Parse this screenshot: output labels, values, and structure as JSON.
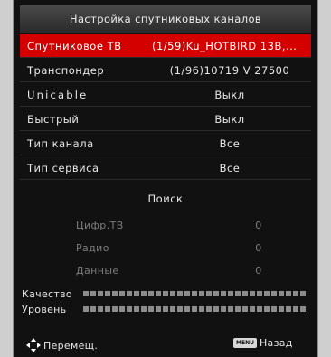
{
  "title": "Настройка спутниковых каналов",
  "rows": [
    {
      "label": "Спутниковое ТВ",
      "value": "(1/59)Ku_HOTBIRD 13B,..."
    },
    {
      "label": "Транспондер",
      "value": "(1/96)10719 V 27500"
    },
    {
      "label": "Unicable",
      "value": "Выкл"
    },
    {
      "label": "Быстрый",
      "value": "Выкл"
    },
    {
      "label": "Тип канала",
      "value": "Все"
    },
    {
      "label": "Тип сервиса",
      "value": "Все"
    }
  ],
  "search_label": "Поиск",
  "results": [
    {
      "label": "Цифр.ТВ",
      "value": "0"
    },
    {
      "label": "Радио",
      "value": "0"
    },
    {
      "label": "Данные",
      "value": "0"
    }
  ],
  "meters": {
    "quality_label": "Качество",
    "level_label": "Уровень"
  },
  "footer": {
    "move_label": "Перемещ.",
    "menu_key": "MENU",
    "back_label": "Назад"
  },
  "colors": {
    "selected": "#d40000",
    "background": "#111111"
  }
}
